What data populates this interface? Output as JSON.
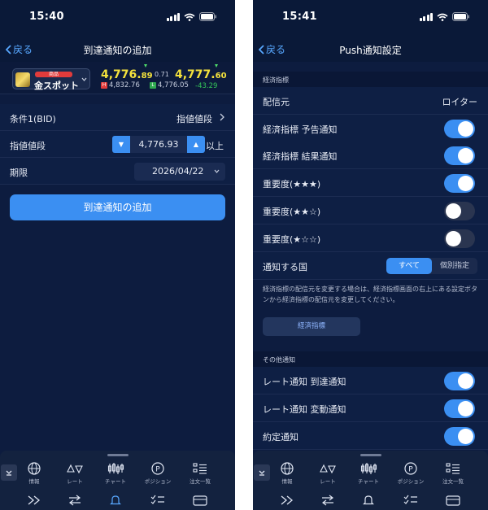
{
  "left": {
    "status_time": "15:40",
    "back_label": "戻る",
    "title": "到達通知の追加",
    "product": {
      "badge": "商品",
      "name": "金スポット"
    },
    "quote": {
      "bid_main": "4,776.",
      "bid_small": "89",
      "spread": "0.71",
      "ask_main": "4,777.",
      "ask_small": "60",
      "high_tag": "H",
      "high": "4,832.76",
      "low_tag": "L",
      "low": "4,776.05",
      "change": "-43.29"
    },
    "condition": {
      "label": "条件1(BID)",
      "value": "指値値段"
    },
    "price": {
      "label": "指値値段",
      "value": "4,776.93",
      "unit": "以上"
    },
    "expiry": {
      "label": "期限",
      "value": "2026/04/22"
    },
    "add_button": "到達通知の追加"
  },
  "right": {
    "status_time": "15:41",
    "back_label": "戻る",
    "title": "Push通知設定",
    "section1": "経済指標",
    "source": {
      "label": "配信元",
      "value": "ロイター"
    },
    "toggles1": [
      {
        "label": "経済指標 予告通知",
        "on": true
      },
      {
        "label": "経済指標 結果通知",
        "on": true
      },
      {
        "label": "重要度(★★★)",
        "on": true
      },
      {
        "label": "重要度(★★☆)",
        "on": false
      },
      {
        "label": "重要度(★☆☆)",
        "on": false
      }
    ],
    "country": {
      "label": "通知する国",
      "options": [
        "すべて",
        "個別指定"
      ],
      "selected": "すべて"
    },
    "note": "経済指標の配信元を変更する場合は、経済指標画面の右上にある設定ボタンから経済指標の配信元を変更してください。",
    "source_button": "経済指標",
    "section2": "その他通知",
    "toggles2": [
      {
        "label": "レート通知 到達通知",
        "on": true
      },
      {
        "label": "レート通知 変動通知",
        "on": true
      },
      {
        "label": "約定通知",
        "on": true
      }
    ]
  },
  "tabs": [
    "情報",
    "レート",
    "チャート",
    "ポジション",
    "注文一覧"
  ],
  "colors": {
    "accent": "#3b8ff2",
    "background": "#0d1c3f",
    "price": "#f4e23c",
    "up": "#34c759"
  }
}
